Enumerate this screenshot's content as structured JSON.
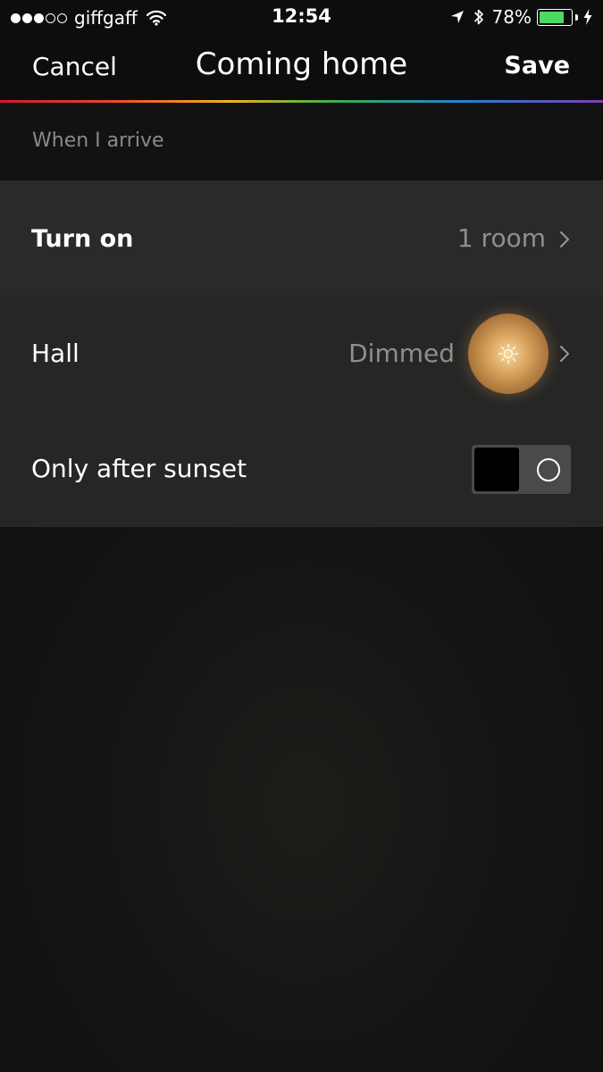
{
  "status_bar": {
    "signal_dots": [
      "full",
      "full",
      "full",
      "empty",
      "empty"
    ],
    "carrier": "giffgaff",
    "time": "12:54",
    "battery_percent": "78%",
    "battery_level": 0.78,
    "battery_color": "#4cd964",
    "icons": [
      "wifi-icon",
      "location-arrow-icon",
      "bluetooth-icon",
      "battery-icon",
      "charging-bolt-icon"
    ]
  },
  "nav": {
    "cancel_label": "Cancel",
    "title": "Coming home",
    "save_label": "Save"
  },
  "section": {
    "header": "When I arrive"
  },
  "rows": {
    "turn_on": {
      "label": "Turn on",
      "value": "1 room"
    },
    "hall": {
      "label": "Hall",
      "value": "Dimmed",
      "light_color": "#d9a35e"
    },
    "sunset": {
      "label": "Only after sunset",
      "toggle_on": false
    }
  },
  "accent_colors": {
    "rainbow": [
      "#d11a2a",
      "#e8462c",
      "#f0b323",
      "#3fae49",
      "#1e88c8",
      "#7a3fb5"
    ]
  }
}
